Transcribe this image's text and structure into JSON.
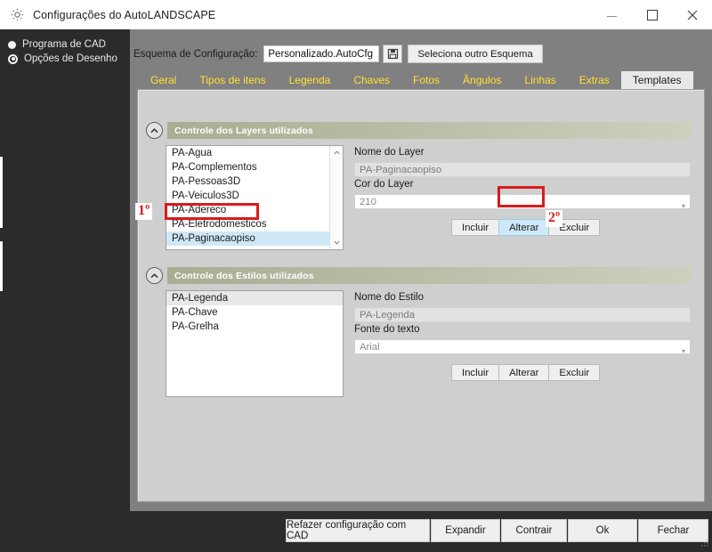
{
  "window": {
    "title": "Configurações do AutoLANDSCAPE",
    "app_icon": "gear-icon",
    "controls": {
      "minimize": "minimize-icon",
      "maximize": "maximize-icon",
      "close": "close-icon"
    }
  },
  "sidebar": {
    "options": [
      {
        "label": "Programa de CAD",
        "selected": false
      },
      {
        "label": "Opções de Desenho",
        "selected": true
      }
    ]
  },
  "scheme": {
    "label": "Esquema de Configuração:",
    "value": "Personalizado.AutoCfg",
    "save_icon": "save-disk-icon",
    "select_button": "Seleciona outro Esquema"
  },
  "tabs": [
    {
      "label": "Geral",
      "active": false
    },
    {
      "label": "Tipos de itens",
      "active": false
    },
    {
      "label": "Legenda",
      "active": false
    },
    {
      "label": "Chaves",
      "active": false
    },
    {
      "label": "Fotos",
      "active": false
    },
    {
      "label": "Ângulos",
      "active": false
    },
    {
      "label": "Linhas",
      "active": false
    },
    {
      "label": "Extras",
      "active": false
    },
    {
      "label": "Templates",
      "active": true
    }
  ],
  "layers_group": {
    "title": "Controle dos Layers utilizados",
    "collapse_icon": "chevron-up-icon",
    "list": [
      {
        "label": "PA-Agua",
        "selected": false
      },
      {
        "label": "PA-Complementos",
        "selected": false
      },
      {
        "label": "PA-Pessoas3D",
        "selected": false
      },
      {
        "label": "PA-Veiculos3D",
        "selected": false
      },
      {
        "label": "PA-Adereco",
        "selected": false
      },
      {
        "label": "PA-Eletrodomesticos",
        "selected": false
      },
      {
        "label": "PA-Paginacaopiso",
        "selected": true
      }
    ],
    "scroll_up_icon": "chevron-up-icon",
    "scroll_down_icon": "chevron-down-icon",
    "name_label": "Nome do Layer",
    "name_value": "PA-Paginacaopiso",
    "color_label": "Cor do Layer",
    "color_value": "210",
    "buttons": [
      {
        "label": "Incluir",
        "highlighted": false
      },
      {
        "label": "Alterar",
        "highlighted": true
      },
      {
        "label": "Excluir",
        "highlighted": false
      }
    ]
  },
  "styles_group": {
    "title": "Controle dos Estilos utilizados",
    "collapse_icon": "chevron-up-icon",
    "list": [
      {
        "label": "PA-Legenda",
        "selected": true
      },
      {
        "label": "PA-Chave",
        "selected": false
      },
      {
        "label": "PA-Grelha",
        "selected": false
      }
    ],
    "name_label": "Nome do Estilo",
    "name_value": "PA-Legenda",
    "font_label": "Fonte do texto",
    "font_value": "Arial",
    "buttons": [
      {
        "label": "Incluir",
        "highlighted": false
      },
      {
        "label": "Alterar",
        "highlighted": false
      },
      {
        "label": "Excluir",
        "highlighted": false
      }
    ]
  },
  "annotations": [
    {
      "marker": "1º",
      "target": "layer-list-selected-row"
    },
    {
      "marker": "2º",
      "target": "layer-alterar-button"
    }
  ],
  "footer": {
    "buttons": [
      "Refazer configuração com CAD",
      "Expandir",
      "Contrair",
      "Ok",
      "Fechar"
    ]
  },
  "colors": {
    "accent_yellow": "#ffe033",
    "annotation_red": "#d91b1b",
    "selection_blue": "#cfe8f7",
    "group_header_olive": "#b9bda6",
    "dialog_gray": "#808080",
    "panel_gray": "#cfcfcf",
    "dark_chrome": "#2b2b2b"
  }
}
